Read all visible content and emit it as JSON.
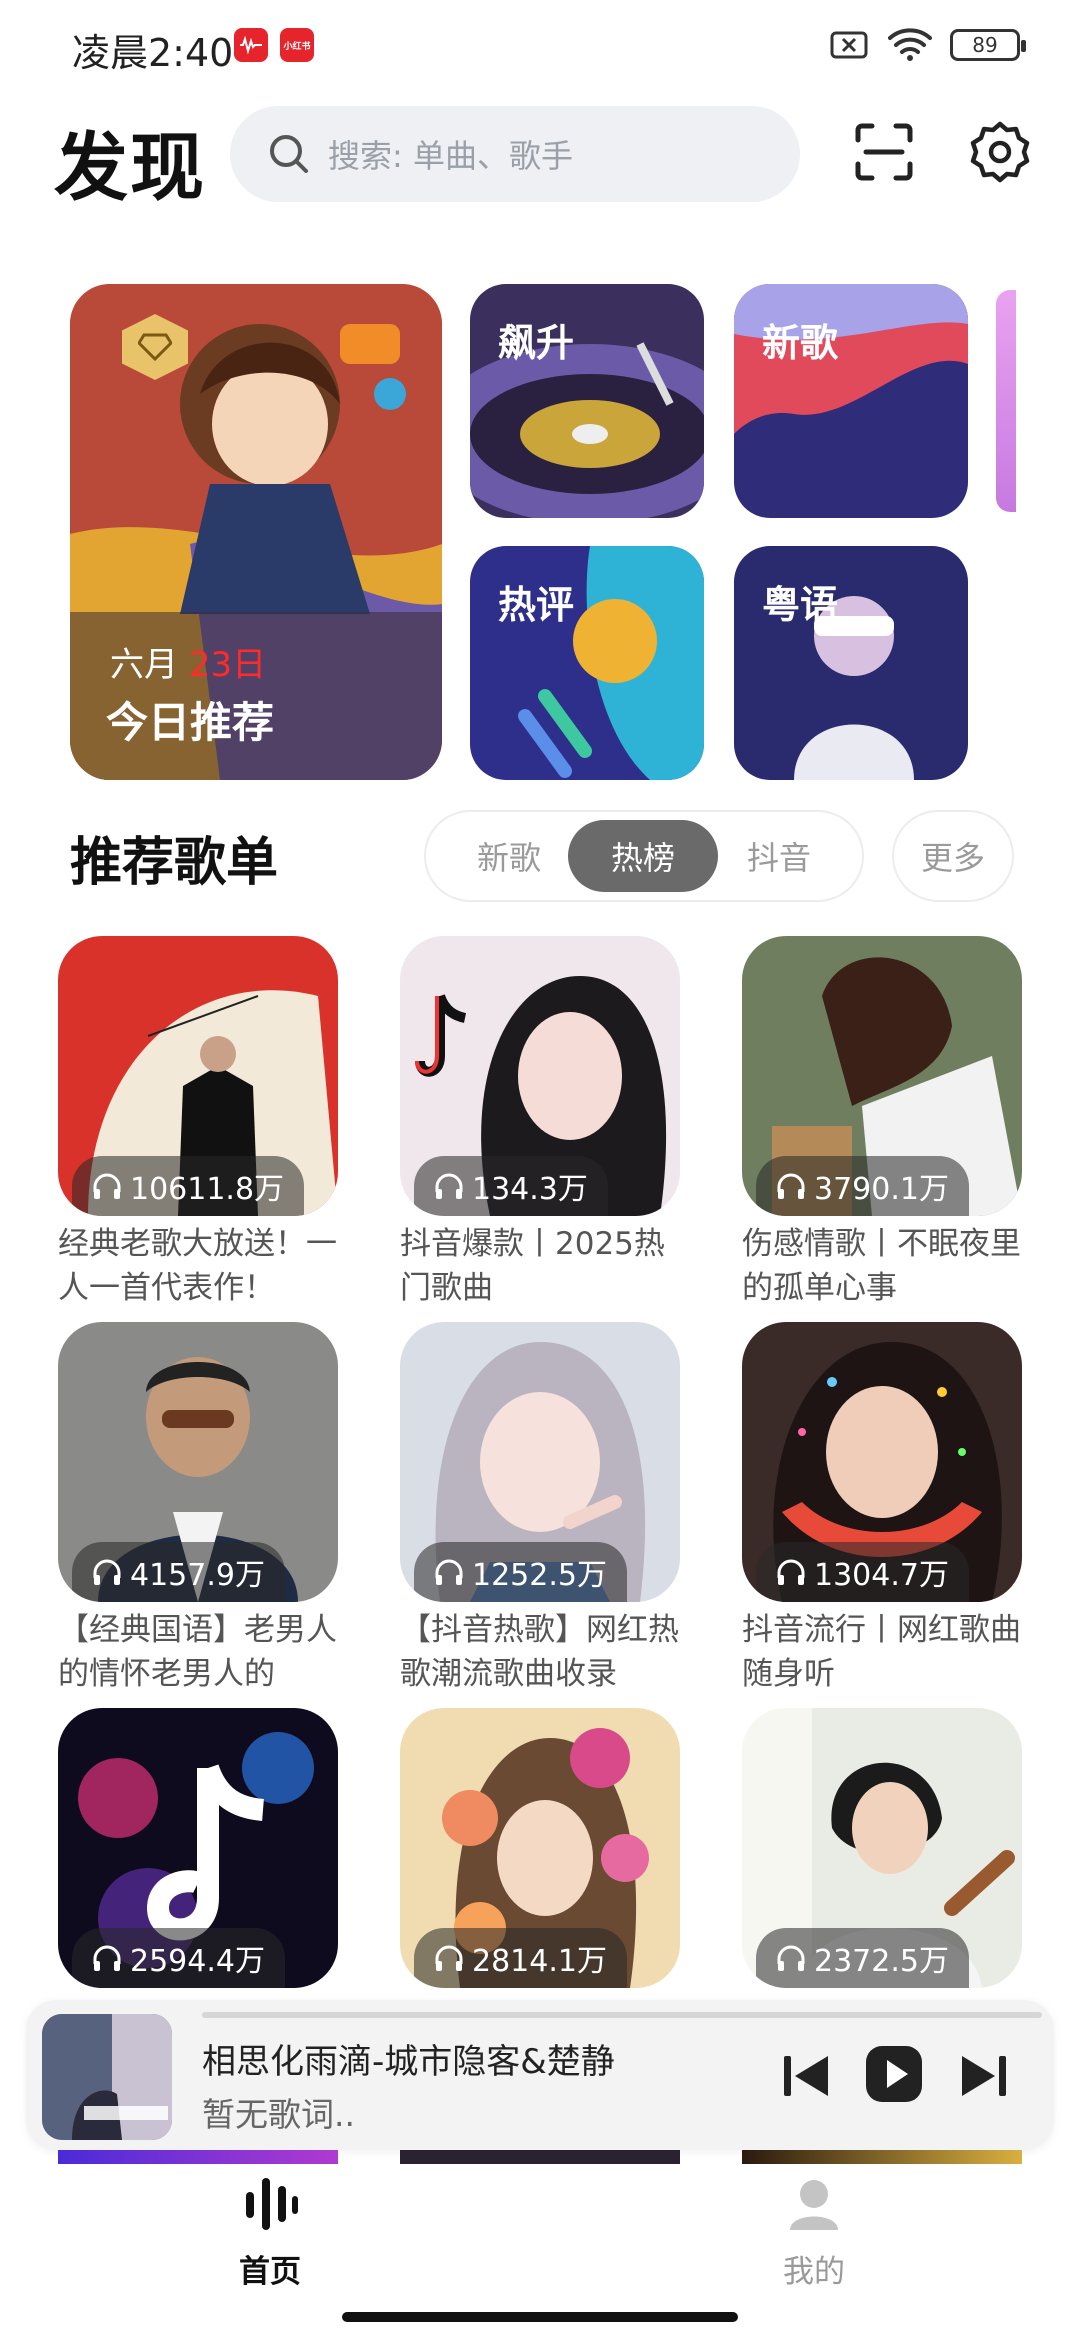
{
  "status_bar": {
    "time": "凌晨2:40",
    "badge_1": "",
    "badge_2": "小红书",
    "battery": "89"
  },
  "header": {
    "title": "发现",
    "search_placeholder": "搜索: 单曲、歌手",
    "icons": [
      "scan-icon",
      "settings-gear-icon"
    ]
  },
  "featured": {
    "daily": {
      "month": "六月",
      "day": "23日",
      "title": "今日推荐"
    },
    "tiles": [
      {
        "label": "飙升"
      },
      {
        "label": "新歌"
      },
      {
        "label": "热评"
      },
      {
        "label": "粤语"
      }
    ]
  },
  "playlists_section": {
    "title": "推荐歌单",
    "tabs": [
      "新歌",
      "热榜",
      "抖音"
    ],
    "active_tab": "热榜",
    "more": "更多",
    "items": [
      {
        "count": "10611.8万",
        "name": "经典老歌大放送！一人一首代表作！"
      },
      {
        "count": "134.3万",
        "name": "抖音爆款丨2025热门歌曲"
      },
      {
        "count": "3790.1万",
        "name": "伤感情歌丨不眠夜里的孤单心事"
      },
      {
        "count": "4157.9万",
        "name": "【经典国语】老男人的情怀老男人的"
      },
      {
        "count": "1252.5万",
        "name": "【抖音热歌】网红热歌潮流歌曲收录"
      },
      {
        "count": "1304.7万",
        "name": "抖音流行丨网红歌曲随身听"
      },
      {
        "count": "2594.4万",
        "name": ""
      },
      {
        "count": "2814.1万",
        "name": ""
      },
      {
        "count": "2372.5万",
        "name": ""
      }
    ]
  },
  "mini_player": {
    "song": "相思化雨滴-城市隐客&楚静",
    "lyric": "暂无歌词..",
    "cover_caption": "城市隐客&楚静"
  },
  "bottom_nav": {
    "items": [
      {
        "label": "首页",
        "active": true
      },
      {
        "label": "我的",
        "active": false
      }
    ]
  },
  "colors": {
    "accent_red": "#ff2a2a",
    "active_tab_bg": "#6a6a6a",
    "search_bg": "#eef0f3"
  }
}
